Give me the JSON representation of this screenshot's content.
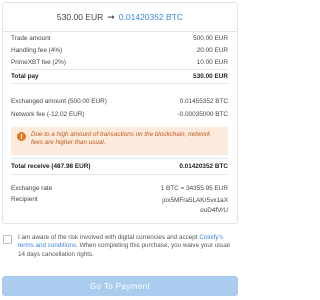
{
  "header": {
    "from_amount": "530.00 EUR",
    "arrow": "➞",
    "to_amount": "0.01420352 BTC"
  },
  "fees": {
    "trade_amount_label": "Trade amount",
    "trade_amount_value": "500.00 EUR",
    "handling_fee_label": "Handling fee (4%)",
    "handling_fee_value": "20.00 EUR",
    "primexbt_fee_label": "PrimeXBT fee (2%)",
    "primexbt_fee_value": "10.00 EUR",
    "total_pay_label": "Total pay",
    "total_pay_value": "530.00 EUR"
  },
  "receive": {
    "exchanged_label": "Exchanged amount (500.00 EUR)",
    "exchanged_value": "0.01455352 BTC",
    "network_fee_label": "Network fee (-12.02 EUR)",
    "network_fee_value": "-0.00035000 BTC",
    "warning_icon": "!",
    "warning_text": "Due to a high amount of transactions on the blockchain, network fees are higher than usual.",
    "total_receive_label": "Total receive (487.98 EUR)",
    "total_receive_value": "0.01420352 BTC"
  },
  "details": {
    "rate_label": "Exchange rate",
    "rate_value": "1 BTC = 34355.95 EUR",
    "recipient_label": "Recipient",
    "recipient_line1": "jox5MFra5LAKr5vx1aX",
    "recipient_line2": "ouD4fVrU"
  },
  "consent": {
    "text_before": "I am aware of the risk involved with digital currencies and accept ",
    "link": "Coinify's terms and conditions",
    "text_after": ". When completing this purchase, you waive your usual 14 days cancellation rights."
  },
  "button": {
    "label": "Go To Payment"
  },
  "colors": {
    "accent": "#3b86e0",
    "warning_bg": "#fcebdc",
    "warning_text": "#c0561c",
    "button_disabled": "#a9ccef"
  }
}
